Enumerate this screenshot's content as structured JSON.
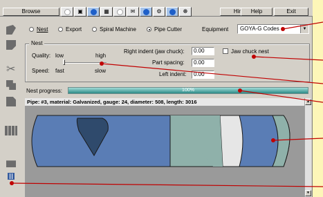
{
  "toolbar": {
    "browse_label": "Browse",
    "hints_label": "Hints",
    "help_label": "Help",
    "exit_label": "Exit",
    "icons": [
      "circle-icon",
      "square-icon",
      "blue-circle-icon",
      "grid-icon",
      "circle-icon",
      "folder-icon",
      "blue-circle-icon",
      "gears-icon",
      "blue-circle-icon",
      "ship-wheel-icon"
    ]
  },
  "modes": {
    "nest": "Nest",
    "export": "Export",
    "spiral": "Spiral Machine",
    "pipe": "Pipe Cutter",
    "selected": "pipe"
  },
  "equipment": {
    "label": "Equipment",
    "value": "GOYA-G Codes"
  },
  "nest": {
    "title": "Nest",
    "quality_label": "Quality:",
    "quality_low": "low",
    "quality_high": "high",
    "speed_label": "Speed:",
    "speed_fast": "fast",
    "speed_slow": "slow",
    "slider_level": 0,
    "right_indent_label": "Right indent (jaw chuck):",
    "right_indent_value": "0.00",
    "part_spacing_label": "Part spacing:",
    "part_spacing_value": "0.00",
    "left_indent_label": "Left indent:",
    "left_indent_value": "0.00",
    "jaw_chuck_label": "Jaw chuck nest",
    "jaw_chuck_checked": false
  },
  "progress": {
    "label": "Nest progress:",
    "value_text": "100%",
    "value": 100
  },
  "pipe": {
    "info": "Pipe: #3, material: Galvanized, gauge: 24, diameter: 508, length: 3016"
  },
  "colors": {
    "window_bg": "#d4d0c8",
    "annotation_bg": "#fdf6b8",
    "callout": "#c00000",
    "pipe_blue": "#5a7db5",
    "pipe_teal": "#8fb1aa",
    "pipe_dark": "#2f4a6c",
    "progress": "#2c8a86"
  }
}
